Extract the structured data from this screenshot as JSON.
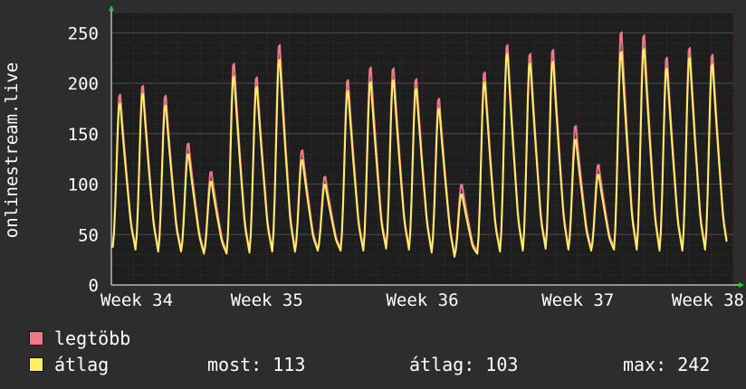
{
  "chart_data": {
    "type": "line",
    "ylabel": "onlinestream.live",
    "yticks": [
      0,
      50,
      100,
      150,
      200,
      250
    ],
    "ylim": [
      0,
      270
    ],
    "x_tick_labels": [
      "Week 34",
      "Week 35",
      "Week 36",
      "Week 37",
      "Week 38"
    ],
    "grid": true,
    "colors": {
      "background": "#2d2d2d",
      "plot_background": "#1e1e1e",
      "grid_minor": "#3a3a3a",
      "grid_major": "#4e4e4e",
      "week_marker": "#7a2020",
      "axis_arrow": "#22cc22",
      "max_series": "#ee7788",
      "avg_series": "#ffee66"
    },
    "series": [
      {
        "name": "legtöbb",
        "color": "#ee7788",
        "daily_peaks": [
          194,
          203,
          193,
          144,
          115,
          226,
          212,
          245,
          137,
          110,
          209,
          222,
          221,
          210,
          190,
          102,
          217,
          245,
          236,
          240,
          162,
          122,
          258,
          255,
          232,
          242,
          235
        ],
        "daily_lows": [
          39,
          37,
          35,
          35,
          33,
          33,
          34,
          35,
          35,
          36,
          36,
          36,
          38,
          37,
          34,
          30,
          33,
          35,
          36,
          38,
          37,
          36,
          37,
          37,
          36,
          36,
          37
        ]
      },
      {
        "name": "átlag",
        "color": "#ffee66",
        "daily_peaks": [
          185,
          195,
          183,
          133,
          105,
          213,
          202,
          230,
          127,
          102,
          198,
          207,
          209,
          200,
          180,
          92,
          207,
          236,
          226,
          228,
          148,
          112,
          238,
          241,
          221,
          232,
          225
        ],
        "daily_lows": [
          37,
          35,
          33,
          33,
          31,
          31,
          32,
          33,
          33,
          34,
          34,
          34,
          36,
          35,
          32,
          28,
          31,
          33,
          34,
          36,
          35,
          34,
          35,
          35,
          34,
          34,
          35
        ]
      }
    ]
  },
  "legend": [
    {
      "label": "legtöbb",
      "color": "#ee7788"
    },
    {
      "label": "átlag",
      "color": "#ffee66"
    }
  ],
  "stats": {
    "most": "most: 113",
    "atlag": "átlag: 103",
    "max": "max: 242"
  }
}
